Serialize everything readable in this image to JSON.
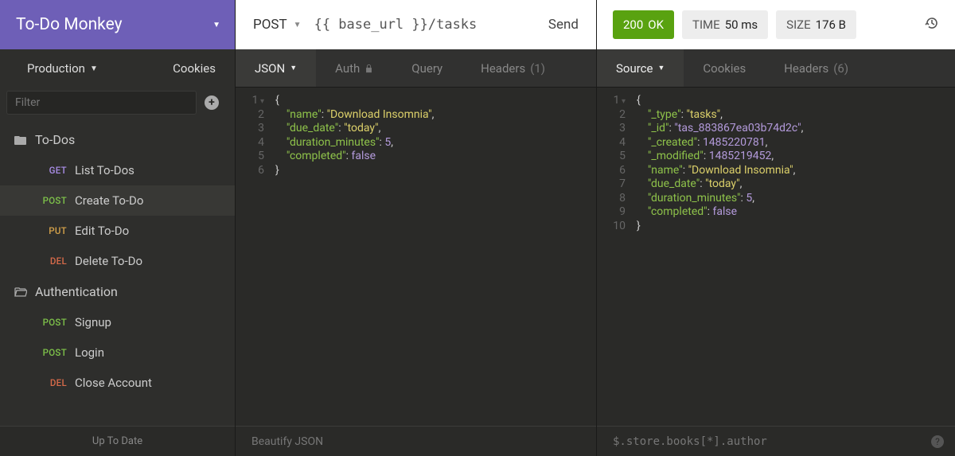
{
  "workspace": {
    "name": "To-Do Monkey"
  },
  "environment": {
    "name": "Production",
    "cookies_label": "Cookies"
  },
  "filter": {
    "placeholder": "Filter"
  },
  "sidebar": {
    "folders": [
      {
        "name": "To-Dos",
        "open": true
      },
      {
        "name": "Authentication",
        "open": true
      }
    ],
    "requests_todos": [
      {
        "method": "GET",
        "name": "List To-Dos"
      },
      {
        "method": "POST",
        "name": "Create To-Do"
      },
      {
        "method": "PUT",
        "name": "Edit To-Do"
      },
      {
        "method": "DEL",
        "name": "Delete To-Do"
      }
    ],
    "requests_auth": [
      {
        "method": "POST",
        "name": "Signup"
      },
      {
        "method": "POST",
        "name": "Login"
      },
      {
        "method": "DEL",
        "name": "Close Account"
      }
    ],
    "status": "Up To Date"
  },
  "request": {
    "method": "POST",
    "url": "{{ base_url }}/tasks",
    "send_label": "Send",
    "tabs": {
      "body": "JSON",
      "auth": "Auth",
      "query": "Query",
      "headers": "Headers",
      "headers_count": "(1)"
    },
    "body_lines": [
      [
        {
          "cls": "tok-brace",
          "t": "{"
        }
      ],
      [
        {
          "pad": "    "
        },
        {
          "cls": "tok-key",
          "t": "\"name\""
        },
        {
          "cls": "tok-punc",
          "t": ": "
        },
        {
          "cls": "tok-str",
          "t": "\"Download Insomnia\""
        },
        {
          "cls": "tok-punc",
          "t": ","
        }
      ],
      [
        {
          "pad": "    "
        },
        {
          "cls": "tok-key",
          "t": "\"due_date\""
        },
        {
          "cls": "tok-punc",
          "t": ": "
        },
        {
          "cls": "tok-str",
          "t": "\"today\""
        },
        {
          "cls": "tok-punc",
          "t": ","
        }
      ],
      [
        {
          "pad": "    "
        },
        {
          "cls": "tok-key",
          "t": "\"duration_minutes\""
        },
        {
          "cls": "tok-punc",
          "t": ": "
        },
        {
          "cls": "tok-num",
          "t": "5"
        },
        {
          "cls": "tok-punc",
          "t": ","
        }
      ],
      [
        {
          "pad": "    "
        },
        {
          "cls": "tok-key",
          "t": "\"completed\""
        },
        {
          "cls": "tok-punc",
          "t": ": "
        },
        {
          "cls": "tok-bool",
          "t": "false"
        }
      ],
      [
        {
          "cls": "tok-brace",
          "t": "}"
        }
      ]
    ],
    "footer_label": "Beautify JSON"
  },
  "response": {
    "status": {
      "code": "200",
      "text": "OK"
    },
    "time": {
      "label": "TIME",
      "value": "50 ms"
    },
    "size": {
      "label": "SIZE",
      "value": "176 B"
    },
    "tabs": {
      "source": "Source",
      "cookies": "Cookies",
      "headers": "Headers",
      "headers_count": "(6)"
    },
    "body_lines": [
      [
        {
          "cls": "tok-brace",
          "t": "{"
        }
      ],
      [
        {
          "pad": "    "
        },
        {
          "cls": "tok-key",
          "t": "\"_type\""
        },
        {
          "cls": "tok-punc",
          "t": ": "
        },
        {
          "cls": "tok-str",
          "t": "\"tasks\""
        },
        {
          "cls": "tok-punc",
          "t": ","
        }
      ],
      [
        {
          "pad": "    "
        },
        {
          "cls": "tok-key",
          "t": "\"_id\""
        },
        {
          "cls": "tok-punc",
          "t": ": "
        },
        {
          "cls": "tok-pstr",
          "t": "\"tas_883867ea03b74d2c\""
        },
        {
          "cls": "tok-punc",
          "t": ","
        }
      ],
      [
        {
          "pad": "    "
        },
        {
          "cls": "tok-key",
          "t": "\"_created\""
        },
        {
          "cls": "tok-punc",
          "t": ": "
        },
        {
          "cls": "tok-num",
          "t": "1485220781"
        },
        {
          "cls": "tok-punc",
          "t": ","
        }
      ],
      [
        {
          "pad": "    "
        },
        {
          "cls": "tok-key",
          "t": "\"_modified\""
        },
        {
          "cls": "tok-punc",
          "t": ": "
        },
        {
          "cls": "tok-num",
          "t": "1485219452"
        },
        {
          "cls": "tok-punc",
          "t": ","
        }
      ],
      [
        {
          "pad": "    "
        },
        {
          "cls": "tok-key",
          "t": "\"name\""
        },
        {
          "cls": "tok-punc",
          "t": ": "
        },
        {
          "cls": "tok-str",
          "t": "\"Download Insomnia\""
        },
        {
          "cls": "tok-punc",
          "t": ","
        }
      ],
      [
        {
          "pad": "    "
        },
        {
          "cls": "tok-key",
          "t": "\"due_date\""
        },
        {
          "cls": "tok-punc",
          "t": ": "
        },
        {
          "cls": "tok-str",
          "t": "\"today\""
        },
        {
          "cls": "tok-punc",
          "t": ","
        }
      ],
      [
        {
          "pad": "    "
        },
        {
          "cls": "tok-key",
          "t": "\"duration_minutes\""
        },
        {
          "cls": "tok-punc",
          "t": ": "
        },
        {
          "cls": "tok-num",
          "t": "5"
        },
        {
          "cls": "tok-punc",
          "t": ","
        }
      ],
      [
        {
          "pad": "    "
        },
        {
          "cls": "tok-key",
          "t": "\"completed\""
        },
        {
          "cls": "tok-punc",
          "t": ": "
        },
        {
          "cls": "tok-bool",
          "t": "false"
        }
      ],
      [
        {
          "cls": "tok-brace",
          "t": "}"
        }
      ]
    ],
    "footer_filter": "$.store.books[*].author"
  }
}
